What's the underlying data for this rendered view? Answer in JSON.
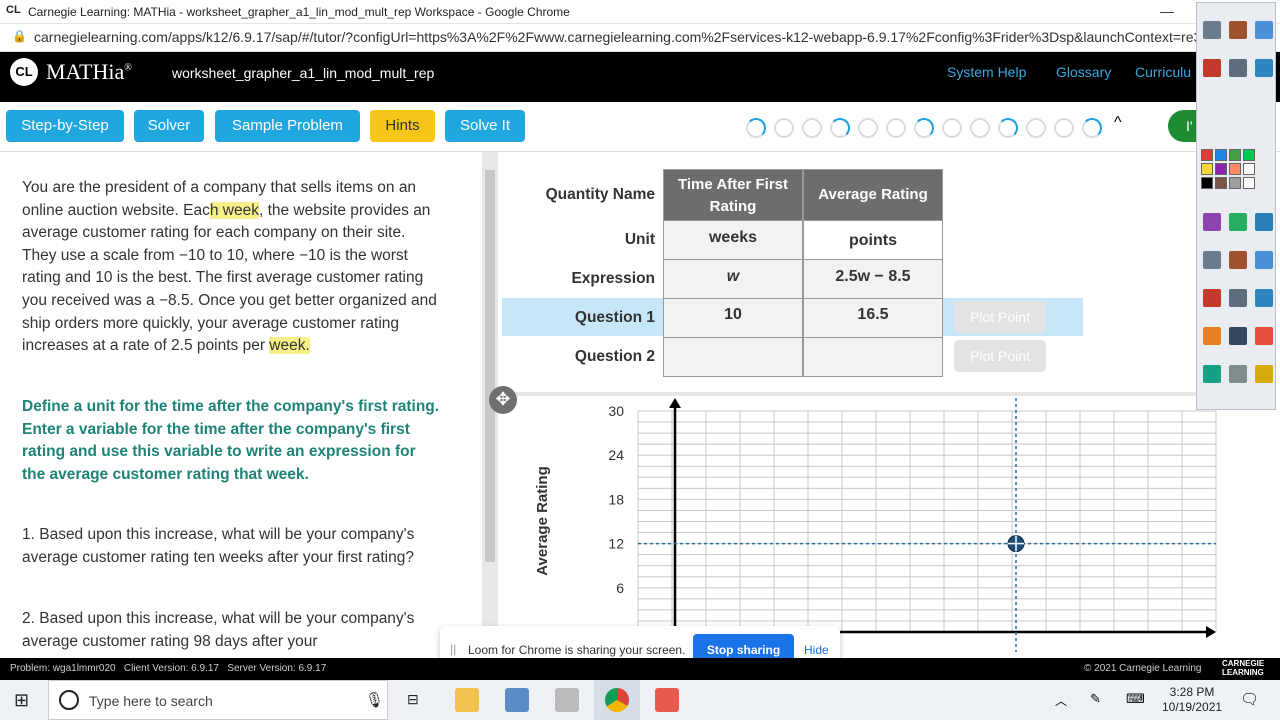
{
  "browser": {
    "logo_text": "CL",
    "title": "Carnegie Learning: MATHia - worksheet_grapher_a1_lin_mod_mult_rep Workspace - Google Chrome",
    "minimize": "—",
    "url": "carnegielearning.com/apps/k12/6.9.17/sap/#/tutor/?configUrl=https%3A%2F%2Fwww.carnegielearning.com%2Fservices-k12-webapp-6.9.17%2Fconfig%3Frider%3Dsp&launchContext=re3ZAxz"
  },
  "header": {
    "logo": "CL",
    "brand": "MATHia",
    "brand_mark": "®",
    "workspace": "worksheet_grapher_a1_lin_mod_mult_rep",
    "links": [
      "System Help",
      "Glossary",
      "Curriculu"
    ]
  },
  "toolbar": {
    "buttons": [
      "Step-by-Step",
      "Solver",
      "Sample Problem",
      "Hints",
      "Solve It"
    ],
    "progress_count": 13,
    "collapse": "^",
    "green_btn": "I'"
  },
  "problem": {
    "p1_a": "You are the president of a company that sells items on an online auction website. Eac",
    "p1_hl1": "h week",
    "p1_b": ", the website provides an average customer rating for each company on their site. They use a scale from −10 to 10, where −10 is the worst rating and 10 is the best. The first average customer rating you received was a −8.5. Once you get better organized and ship orders more quickly, your average customer rating increases at a rate of 2.5 points per ",
    "p1_hl2": "week.",
    "instruction": "Define a unit for the time after the company's first rating. Enter a variable for the time after the company's first rating and use this variable to write an expression for the average customer rating that week.",
    "q1": "1.  Based upon this increase, what will be your company's average customer rating ten weeks after your first rating?",
    "q2": "2.  Based upon this increase, what will be your company's average customer rating 98 days after your"
  },
  "table": {
    "row_labels": [
      "Quantity Name",
      "Unit",
      "Expression",
      "Question 1",
      "Question 2"
    ],
    "col1": {
      "name": "Time After First Rating",
      "unit": "weeks",
      "expr": "w",
      "q1": "10",
      "q2": ""
    },
    "col2": {
      "name": "Average Rating",
      "unit": "points",
      "expr": "2.5w − 8.5",
      "q1": "16.5",
      "q2": ""
    },
    "plot_point": "Plot Point"
  },
  "graph": {
    "ylabel": "Average Rating",
    "yticks": [
      "30",
      "24",
      "18",
      "12",
      "6",
      "0"
    ],
    "move_icon": "✥"
  },
  "chart_data": {
    "type": "scatter",
    "ylabel": "Average Rating",
    "xlabel": "",
    "ylim": [
      0,
      30
    ],
    "yticks": [
      0,
      6,
      12,
      18,
      24,
      30
    ],
    "grid": true,
    "points": [
      {
        "y": 12
      }
    ]
  },
  "loom": {
    "grip": "||",
    "text": "Loom for Chrome is sharing your screen.",
    "stop": "Stop sharing",
    "hide": "Hide"
  },
  "status": {
    "left": "Problem: wga1lmmr020   Client Version: 6.9.17   Server Version: 6.9.17",
    "right": "© 2021 Carnegie Learning",
    "brand_line1": "CARNEGIE",
    "brand_line2": "LEARNING"
  },
  "taskbar": {
    "search_placeholder": "Type here to search",
    "time": "3:28 PM",
    "date": "10/19/2021"
  },
  "colors": {
    "accent": "#21a7e0",
    "hint": "#f5c518",
    "header": "#000000",
    "teal": "#1f8378",
    "selected_row": "#c6e7f8"
  }
}
